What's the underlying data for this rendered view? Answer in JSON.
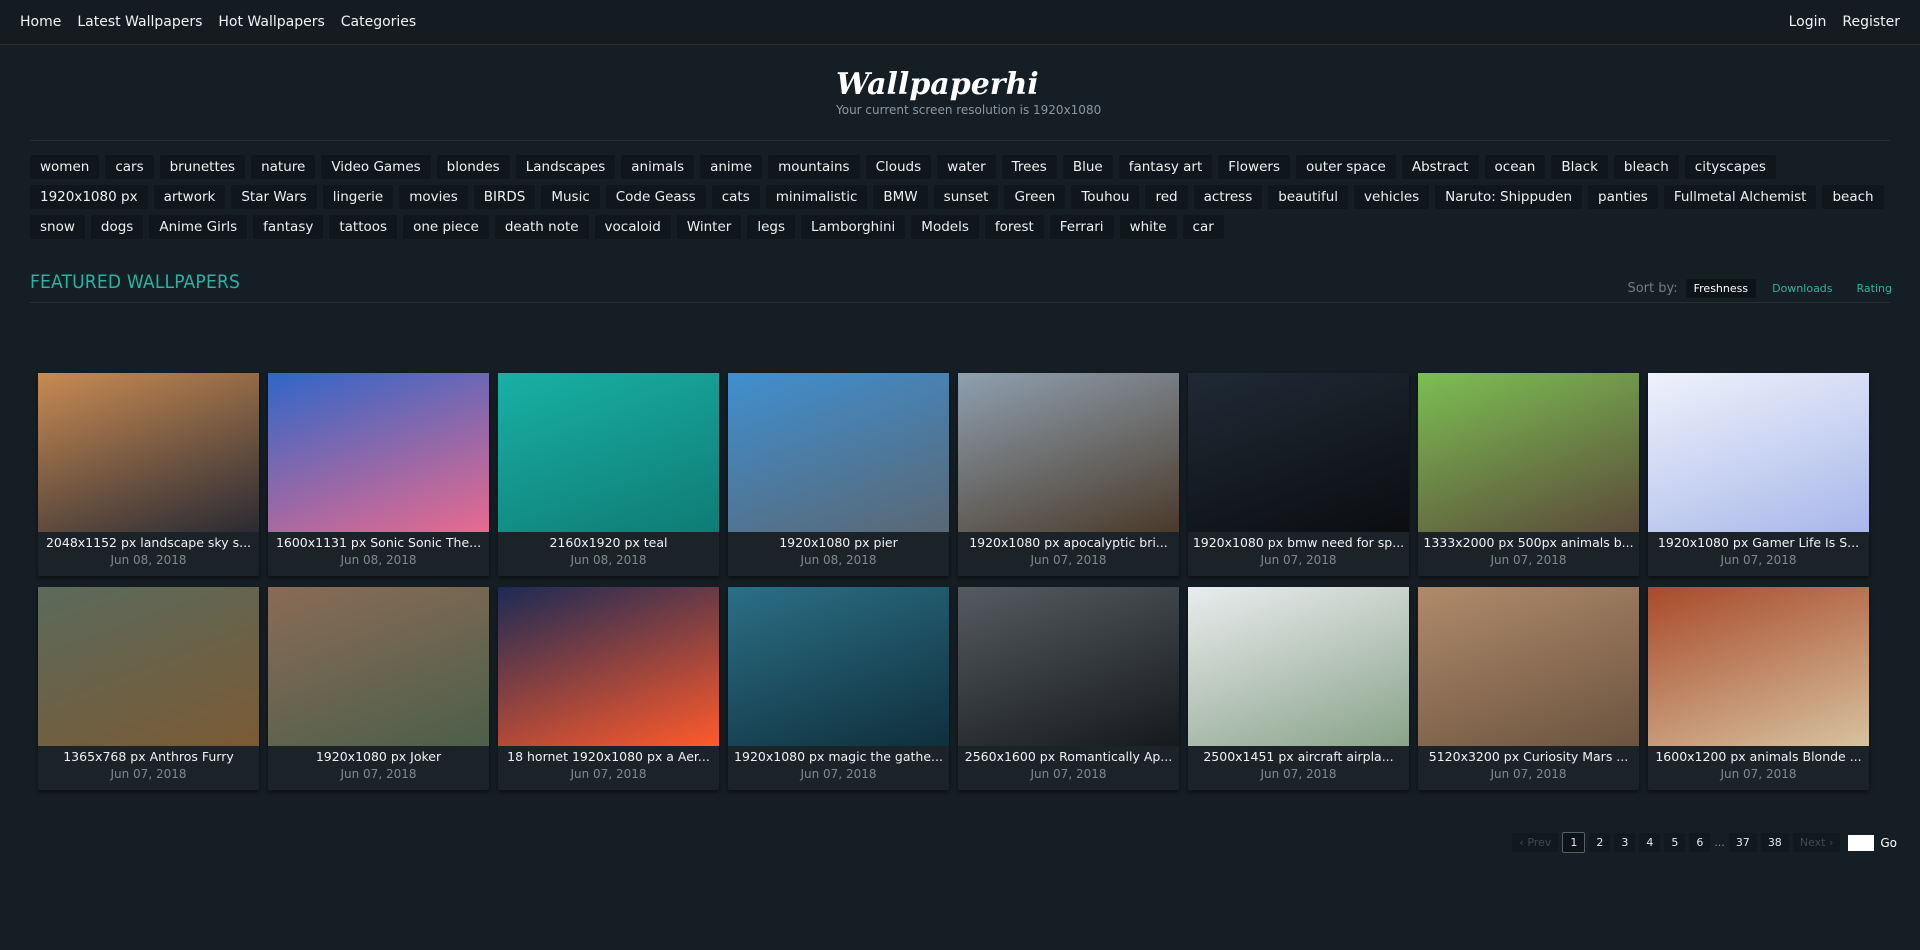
{
  "nav": {
    "left": [
      "Home",
      "Latest Wallpapers",
      "Hot Wallpapers",
      "Categories"
    ],
    "right": [
      "Login",
      "Register"
    ]
  },
  "brand": {
    "logo_text": "Wallpaperhi",
    "resolution_text": "Your current screen resolution is 1920x1080"
  },
  "tags": [
    "women",
    "cars",
    "brunettes",
    "nature",
    "Video Games",
    "blondes",
    "Landscapes",
    "animals",
    "anime",
    "mountains",
    "Clouds",
    "water",
    "Trees",
    "Blue",
    "fantasy art",
    "Flowers",
    "outer space",
    "Abstract",
    "ocean",
    "Black",
    "bleach",
    "cityscapes",
    "1920x1080 px",
    "artwork",
    "Star Wars",
    "lingerie",
    "movies",
    "BIRDS",
    "Music",
    "Code Geass",
    "cats",
    "minimalistic",
    "BMW",
    "sunset",
    "Green",
    "Touhou",
    "red",
    "actress",
    "beautiful",
    "vehicles",
    "Naruto: Shippuden",
    "panties",
    "Fullmetal Alchemist",
    "beach",
    "snow",
    "dogs",
    "Anime Girls",
    "fantasy",
    "tattoos",
    "one piece",
    "death note",
    "vocaloid",
    "Winter",
    "legs",
    "Lamborghini",
    "Models",
    "forest",
    "Ferrari",
    "white",
    "car"
  ],
  "section": {
    "title": "FEATURED WALLPAPERS",
    "sort_label": "Sort by:",
    "sort_options": [
      "Freshness",
      "Downloads",
      "Rating"
    ],
    "sort_active": "Freshness"
  },
  "wallpapers": [
    {
      "caption": "2048x1152 px landscape sky s...",
      "date": "Jun 08, 2018",
      "colors": [
        "#c98b52",
        "#2a2a33"
      ]
    },
    {
      "caption": "1600x1131 px Sonic Sonic The...",
      "date": "Jun 08, 2018",
      "colors": [
        "#2f66c8",
        "#e86a8e"
      ]
    },
    {
      "caption": "2160x1920 px teal",
      "date": "Jun 08, 2018",
      "colors": [
        "#19b0a5",
        "#0e7c74"
      ]
    },
    {
      "caption": "1920x1080 px pier",
      "date": "Jun 08, 2018",
      "colors": [
        "#3f8fd0",
        "#5a6774"
      ]
    },
    {
      "caption": "1920x1080 px apocalyptic bri...",
      "date": "Jun 07, 2018",
      "colors": [
        "#8fa0b0",
        "#4a3a2a"
      ]
    },
    {
      "caption": "1920x1080 px bmw need for sp...",
      "date": "Jun 07, 2018",
      "colors": [
        "#1f2a36",
        "#0b0d10"
      ]
    },
    {
      "caption": "1333x2000 px 500px animals b...",
      "date": "Jun 07, 2018",
      "colors": [
        "#7cbf52",
        "#5b4a3a"
      ]
    },
    {
      "caption": "1920x1080 px Gamer Life Is S...",
      "date": "Jun 07, 2018",
      "colors": [
        "#eef2fb",
        "#a9b7ea"
      ]
    },
    {
      "caption": "1365x768 px Anthros Furry",
      "date": "Jun 07, 2018",
      "colors": [
        "#5b6a5c",
        "#7a5a34"
      ]
    },
    {
      "caption": "1920x1080 px Joker",
      "date": "Jun 07, 2018",
      "colors": [
        "#8a6b56",
        "#4c5f4a"
      ]
    },
    {
      "caption": "18 hornet 1920x1080 px a Aer...",
      "date": "Jun 07, 2018",
      "colors": [
        "#1c2a55",
        "#ff5a2a"
      ]
    },
    {
      "caption": "1920x1080 px magic the gathe...",
      "date": "Jun 07, 2018",
      "colors": [
        "#2b6f86",
        "#0f2f3c"
      ]
    },
    {
      "caption": "2560x1600 px Romantically Ap...",
      "date": "Jun 07, 2018",
      "colors": [
        "#555b60",
        "#16191c"
      ]
    },
    {
      "caption": "2500x1451 px aircraft airpla...",
      "date": "Jun 07, 2018",
      "colors": [
        "#e9ecee",
        "#8aa38a"
      ]
    },
    {
      "caption": "5120x3200 px Curiosity Mars ...",
      "date": "Jun 07, 2018",
      "colors": [
        "#b08a6a",
        "#6b5440"
      ]
    },
    {
      "caption": "1600x1200 px animals Blonde ...",
      "date": "Jun 07, 2018",
      "colors": [
        "#a84a2a",
        "#d7c2a0"
      ]
    }
  ],
  "pagination": {
    "prev": "Prev",
    "next": "Next",
    "pages": [
      "1",
      "2",
      "3",
      "4",
      "5",
      "6"
    ],
    "ellipsis": "...",
    "last_pages": [
      "37",
      "38"
    ],
    "current": "1",
    "go": "Go"
  }
}
